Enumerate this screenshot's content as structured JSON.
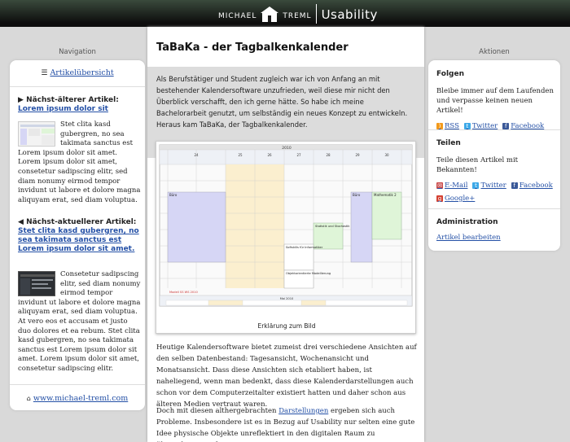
{
  "header": {
    "brand_first": "MICHAEL",
    "brand_last": "TREML",
    "brand_section": "Usability"
  },
  "navigation": {
    "heading": "Navigation",
    "overview_link": "Artikelübersicht",
    "older": {
      "label": "Nächst-älterer Artikel:",
      "link": "Lorem ipsum dolor sit",
      "text": "Stet clita kasd gubergren, no sea takimata sanctus est Lorem ipsum dolor sit amet. Lorem ipsum dolor sit amet, consetetur sadipscing elitr, sed diam nonumy eirmod tempor invidunt ut labore et dolore magna aliquyam erat, sed diam voluptua."
    },
    "newer": {
      "label": "Nächst-aktuellerer Artikel:",
      "link": "Stet clita kasd gubergren, no sea takimata sanctus est Lorem ipsum dolor sit amet.",
      "text": "Consetetur sadipscing elitr, sed diam nonumy eirmod tempor invidunt ut labore et dolore magna aliquyam erat, sed diam voluptua. At vero eos et accusam et justo duo dolores et ea rebum. Stet clita kasd gubergren, no sea takimata sanctus est Lorem ipsum dolor sit amet. Lorem ipsum dolor sit amet, consetetur sadipscing elitr."
    },
    "footer_link": "www.michael-treml.com"
  },
  "article": {
    "title": "TaBaKa - der Tagbalkenkalender",
    "intro": "Als Berufstätiger und Student zugleich war ich von Anfang an mit bestehender Kalendersoftware unzufrieden, weil diese mir nicht den Überblick verschafft, den ich gerne hätte. So habe ich meine Bachelorarbeit genutzt, um selbständig ein neues Konzept zu entwickeln. Heraus kam TaBaKa, der Tagbalkenkalender.",
    "figure_caption": "Erklärung zum Bild",
    "paragraph1": "Heutige Kalendersoftware bietet zumeist drei verschiedene Ansichten auf den selben Datenbestand: Tagesansicht, Wochenansicht und Monatsansicht. Dass diese Ansichten sich etabliert haben, ist naheliegend, wenn man bedenkt, dass diese Kalenderdarstellungen auch schon vor dem Computerzeitalter existiert hatten und daher schon aus älteren Medien vertraut waren.",
    "paragraph2_before": "Doch mit diesen althergebrachten ",
    "paragraph2_link": "Darstellungen",
    "paragraph2_after": " ergeben sich auch Probleme. Insbesondere ist es in Bezug auf Usability nur selten eine gute Idee physische Objekte unreflektiert in den digitalen Raum zu übernehmen. Auf Papier",
    "calendar": {
      "year_label": "2010",
      "days": [
        "24",
        "25",
        "26",
        "27",
        "28",
        "29",
        "30"
      ],
      "events": [
        "Büro",
        "Büro",
        "Mathematik 2",
        "Statistik und Stochastik",
        "Softskills für Informatiker",
        "Objektorientierte Modellierung"
      ],
      "month_label": "Mai 2010",
      "legend_label": "Modell  SS  WS 2010"
    }
  },
  "actions": {
    "heading": "Aktionen",
    "follow_title": "Folgen",
    "follow_text": "Bleibe immer auf dem Laufenden und verpasse keinen neuen Artikel!",
    "follow_links": [
      "RSS",
      "Twitter",
      "Facebook"
    ],
    "share_title": "Teilen",
    "share_text": "Teile diesen Artikel mit Bekannten!",
    "share_links": [
      "E-Mail",
      "Twitter",
      "Facebook",
      "Google+"
    ],
    "admin_title": "Administration",
    "admin_link": "Artikel bearbeiten"
  },
  "colors": {
    "accent_link": "#2450a6",
    "event_blue": "#d6d6f5",
    "event_green": "#dff5d8",
    "weekend_yellow": "#fbefcf"
  }
}
